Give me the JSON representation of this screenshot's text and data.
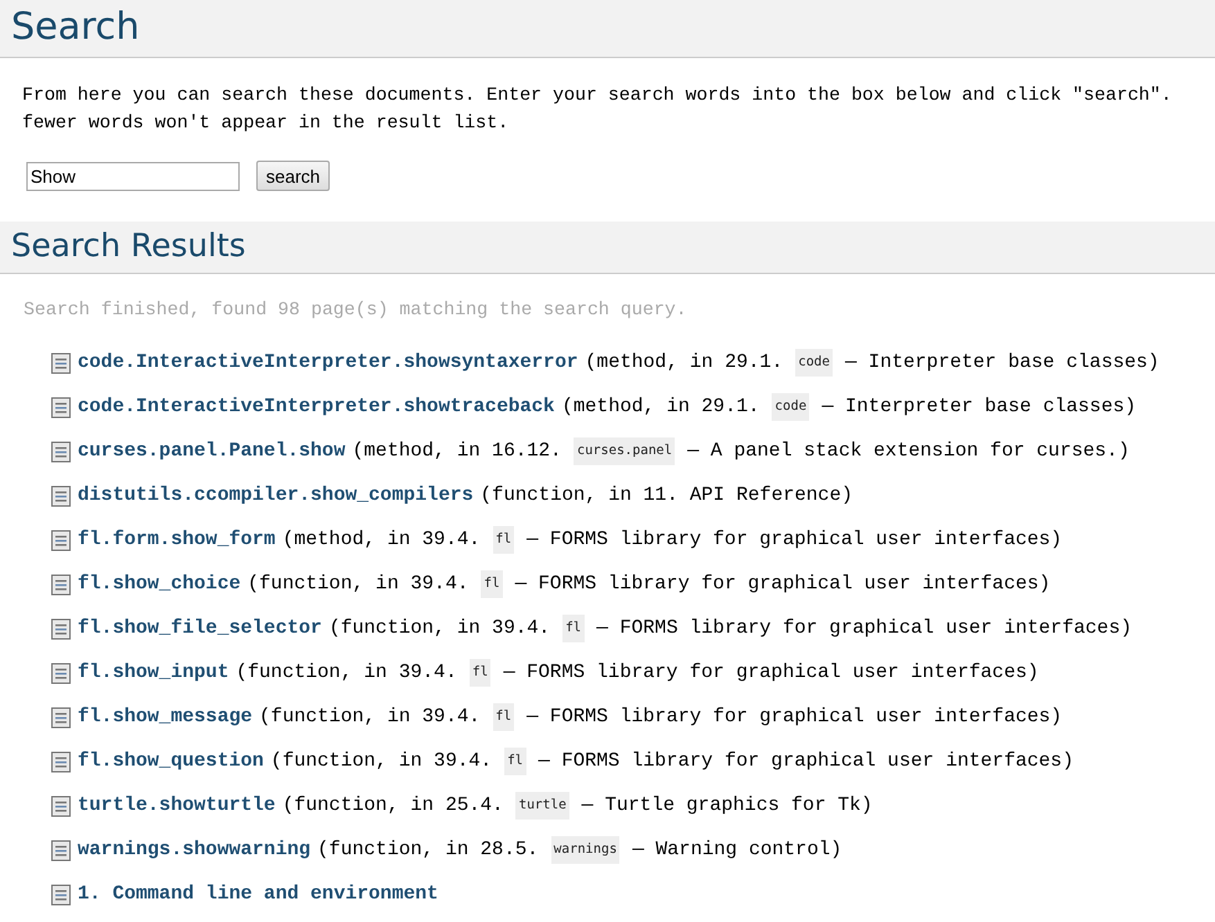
{
  "heading": "Search",
  "intro": [
    "From here you can search these documents. Enter your search words into the box below and click \"search\".",
    "fewer words won't appear in the result list."
  ],
  "search": {
    "value": "Show",
    "button": "search"
  },
  "results_heading": "Search Results",
  "summary": "Search finished, found 98 page(s) matching the search query.",
  "results": [
    {
      "title": "code.InteractiveInterpreter.showsyntaxerror",
      "context": "(method, in 29.1.",
      "module": "code",
      "description": "— Interpreter base classes)"
    },
    {
      "title": "code.InteractiveInterpreter.showtraceback",
      "context": "(method, in 29.1.",
      "module": "code",
      "description": "— Interpreter base classes)"
    },
    {
      "title": "curses.panel.Panel.show",
      "context": "(method, in 16.12.",
      "module": "curses.panel",
      "description": "— A panel stack extension for curses.)"
    },
    {
      "title": "distutils.ccompiler.show_compilers",
      "context": "(function, in 11. API Reference)"
    },
    {
      "title": "fl.form.show_form",
      "context": "(method, in 39.4.",
      "module": "fl",
      "description": "— FORMS library for graphical user interfaces)"
    },
    {
      "title": "fl.show_choice",
      "context": "(function, in 39.4.",
      "module": "fl",
      "description": "— FORMS library for graphical user interfaces)"
    },
    {
      "title": "fl.show_file_selector",
      "context": "(function, in 39.4.",
      "module": "fl",
      "description": "— FORMS library for graphical user interfaces)"
    },
    {
      "title": "fl.show_input",
      "context": "(function, in 39.4.",
      "module": "fl",
      "description": "— FORMS library for graphical user interfaces)"
    },
    {
      "title": "fl.show_message",
      "context": "(function, in 39.4.",
      "module": "fl",
      "description": "— FORMS library for graphical user interfaces)"
    },
    {
      "title": "fl.show_question",
      "context": "(function, in 39.4.",
      "module": "fl",
      "description": "— FORMS library for graphical user interfaces)"
    },
    {
      "title": "turtle.showturtle",
      "context": "(function, in 25.4.",
      "module": "turtle",
      "description": "— Turtle graphics for Tk)"
    },
    {
      "title": "warnings.showwarning",
      "context": "(function, in 28.5.",
      "module": "warnings",
      "description": "— Warning control)"
    },
    {
      "title": "1. Command line and environment"
    }
  ]
}
